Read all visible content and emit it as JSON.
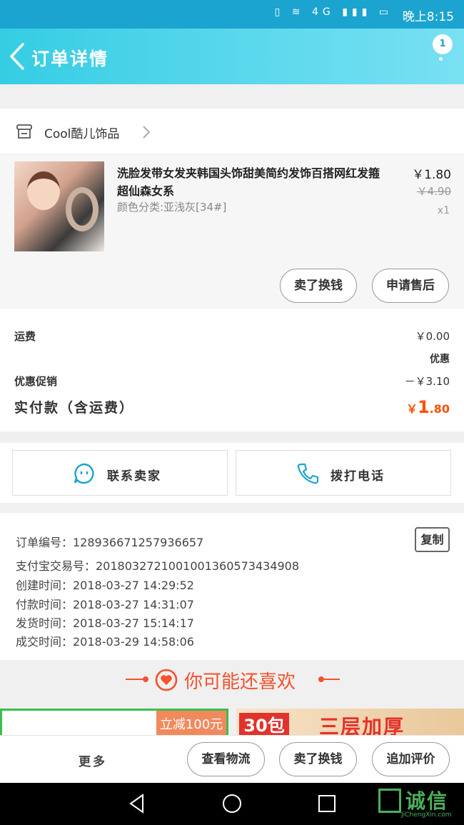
{
  "status_bar": {
    "time": "晚上8:15",
    "icons": "▯ ≋ 4G ▮▮▮ ▭"
  },
  "header": {
    "title": "订单详情",
    "badge": "1"
  },
  "shop": {
    "name": "Cool酷儿饰品"
  },
  "product": {
    "title": "洗脸发带女发夹韩国头饰甜美简约发饰百搭网红发箍超仙森女系",
    "sku": "颜色分类:亚浅灰[34#]",
    "price": "￥1.80",
    "original_price": "￥4.90",
    "quantity": "x1",
    "buttons": {
      "sell_swap": "卖了换钱",
      "after_sale": "申请售后"
    }
  },
  "fees": {
    "shipping_label": "运费",
    "shipping_value": "￥0.00",
    "discount_tag": "优惠",
    "promo_label": "优惠促销",
    "promo_value": "－￥3.10",
    "total_label": "实付款（含运费）",
    "total_currency": "￥",
    "total_int": "1",
    "total_dec": ".80"
  },
  "contact": {
    "seller": "联系卖家",
    "call": "拨打电话"
  },
  "order_info": {
    "order_no": "订单编号：128936671257936657",
    "alipay_no": "支付宝交易号：2018032721001001360573434908",
    "created": "创建时间：2018-03-27 14:29:52",
    "paid": "付款时间：2018-03-27 14:31:07",
    "shipped": "发货时间：2018-03-27 15:14:17",
    "completed": "成交时间：2018-03-29 14:58:06",
    "copy_label": "复制"
  },
  "recommend": {
    "title": "你可能还喜欢",
    "card1_tag": "立减100元",
    "card2_tag": "30包",
    "card2_text": "三层加厚"
  },
  "bottom_bar": {
    "more": "更多",
    "logistics": "查看物流",
    "sell_swap": "卖了换钱",
    "add_review": "追加评价"
  },
  "watermark": {
    "text": "诚信",
    "sub": "JiChengXin.com"
  },
  "colors": {
    "header_start": "#35cde3",
    "accent_orange": "#ff5000",
    "recommend_red": "#f5522d"
  }
}
